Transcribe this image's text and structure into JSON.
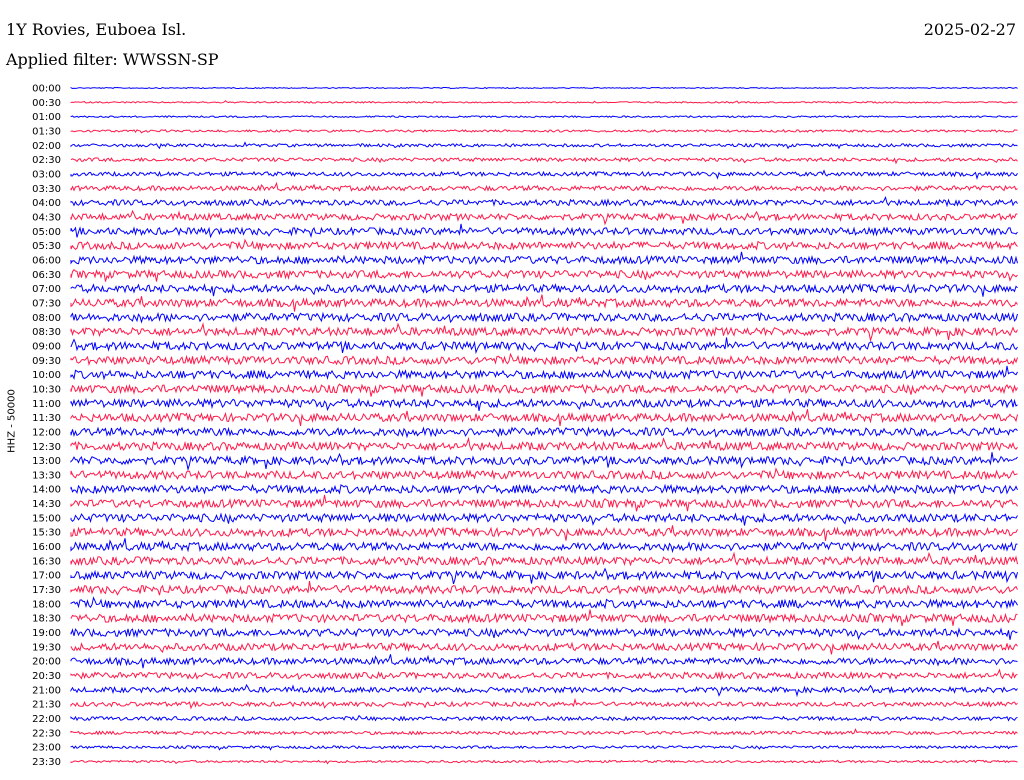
{
  "header": {
    "station": "1Y Rovies, Euboea Isl.",
    "date": "2025-02-27",
    "filter": "Applied filter: WWSSN-SP"
  },
  "chart_data": {
    "type": "line",
    "subtype": "helicorder",
    "ylabel": "HHZ - 50000",
    "colors": [
      "#0000ff",
      "#ff1a4a"
    ],
    "row_interval_minutes": 30,
    "rows": [
      "00:00",
      "00:30",
      "01:00",
      "01:30",
      "02:00",
      "02:30",
      "03:00",
      "03:30",
      "04:00",
      "04:30",
      "05:00",
      "05:30",
      "06:00",
      "06:30",
      "07:00",
      "07:30",
      "08:00",
      "08:30",
      "09:00",
      "09:30",
      "10:00",
      "10:30",
      "11:00",
      "11:30",
      "12:00",
      "12:30",
      "13:00",
      "13:30",
      "14:00",
      "14:30",
      "15:00",
      "15:30",
      "16:00",
      "16:30",
      "17:00",
      "17:30",
      "18:00",
      "18:30",
      "19:00",
      "19:30",
      "20:00",
      "20:30",
      "21:00",
      "21:30",
      "22:00",
      "22:30",
      "23:00",
      "23:30"
    ],
    "noise_amplitude_per_row": [
      0.5,
      0.7,
      0.8,
      1.1,
      1.5,
      1.8,
      2.0,
      2.4,
      2.8,
      3.2,
      3.5,
      3.7,
      3.8,
      3.8,
      3.9,
      4.0,
      4.0,
      4.0,
      4.0,
      4.0,
      4.0,
      4.0,
      4.0,
      4.0,
      4.0,
      4.0,
      4.0,
      4.0,
      4.0,
      4.0,
      4.0,
      4.0,
      4.0,
      4.0,
      4.0,
      4.0,
      4.0,
      4.0,
      3.8,
      3.6,
      3.3,
      3.0,
      2.6,
      2.2,
      1.9,
      1.6,
      1.3,
      1.1
    ]
  }
}
